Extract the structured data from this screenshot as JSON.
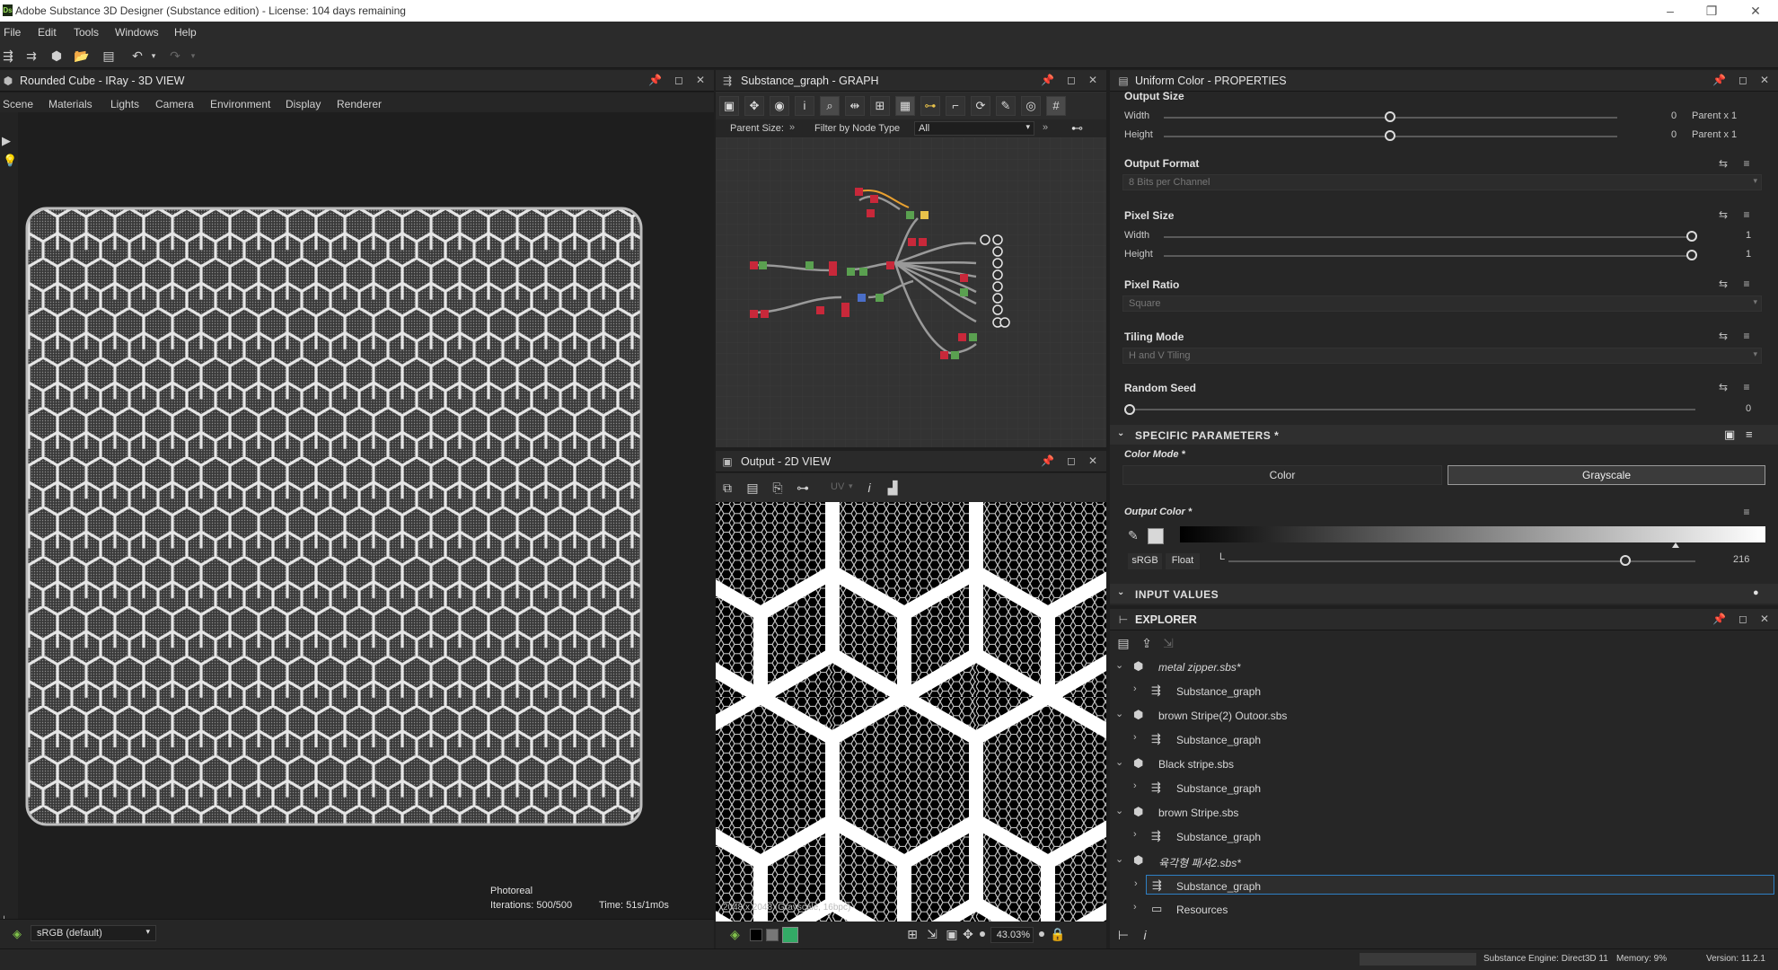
{
  "app": {
    "title": "Adobe Substance 3D Designer (Substance edition) - License: 104 days remaining",
    "logo": "Ds"
  },
  "menu": [
    "File",
    "Edit",
    "Tools",
    "Windows",
    "Help"
  ],
  "view3d": {
    "title": "Rounded Cube - IRay - 3D VIEW",
    "tabs": [
      "Scene",
      "Materials",
      "Lights",
      "Camera",
      "Environment",
      "Display",
      "Renderer"
    ],
    "render_mode": "Photoreal",
    "iterations": "Iterations: 500/500",
    "time": "Time: 51s/1m0s",
    "colorspace": "sRGB (default)"
  },
  "graph": {
    "title": "Substance_graph - GRAPH",
    "parent_size_label": "Parent Size:",
    "filter_label": "Filter by Node Type",
    "filter_value": "All"
  },
  "view2d": {
    "title": "Output - 2D VIEW",
    "uv_label": "UV",
    "image_info": "2048 x 2048 (Grayscale, 16bpc)",
    "zoom": "43.03%"
  },
  "properties": {
    "title": "Uniform Color - PROPERTIES",
    "output_size": {
      "label": "Output Size",
      "width_label": "Width",
      "width_value": "0",
      "width_rel": "Parent x 1",
      "width_level": 0.5,
      "height_label": "Height",
      "height_value": "0",
      "height_rel": "Parent x 1",
      "height_level": 0.5
    },
    "output_format": {
      "label": "Output Format",
      "value": "8 Bits per Channel"
    },
    "pixel_size": {
      "label": "Pixel Size",
      "width_label": "Width",
      "width_value": "1",
      "width_level": 1.0,
      "height_label": "Height",
      "height_value": "1",
      "height_level": 1.0
    },
    "pixel_ratio": {
      "label": "Pixel Ratio",
      "value": "Square"
    },
    "tiling_mode": {
      "label": "Tiling Mode",
      "value": "H and V Tiling"
    },
    "random_seed": {
      "label": "Random Seed",
      "value": "0",
      "level": 0.0
    },
    "specific_header": "SPECIFIC PARAMETERS *",
    "color_mode": {
      "label": "Color Mode *",
      "option_a": "Color",
      "option_b": "Grayscale",
      "selected": "Grayscale"
    },
    "output_color": {
      "label": "Output Color *",
      "space": "sRGB",
      "format": "Float",
      "channel": "L",
      "value": "216",
      "level": 0.847
    },
    "input_header": "INPUT VALUES"
  },
  "explorer": {
    "title": "EXPLORER",
    "rows": [
      {
        "label": "metal zipper.sbs*",
        "kind": "package",
        "italic": true
      },
      {
        "label": "Substance_graph",
        "kind": "graph"
      },
      {
        "label": "brown Stripe(2) Outoor.sbs",
        "kind": "package"
      },
      {
        "label": "Substance_graph",
        "kind": "graph"
      },
      {
        "label": "Black stripe.sbs",
        "kind": "package"
      },
      {
        "label": "Substance_graph",
        "kind": "graph"
      },
      {
        "label": "brown Stripe.sbs",
        "kind": "package"
      },
      {
        "label": "Substance_graph",
        "kind": "graph"
      },
      {
        "label": "육각형 패셔2.sbs*",
        "kind": "package",
        "italic": true
      },
      {
        "label": "Substance_graph",
        "kind": "graph",
        "selected": true
      },
      {
        "label": "Resources",
        "kind": "folder"
      }
    ]
  },
  "status": {
    "engine": "Substance Engine: Direct3D 11",
    "memory": "Memory: 9%",
    "version": "Version: 11.2.1"
  },
  "colors": {
    "accent": "#2e7fc4",
    "panel": "#2a2a2a",
    "viewport": "#1f1f1f"
  }
}
